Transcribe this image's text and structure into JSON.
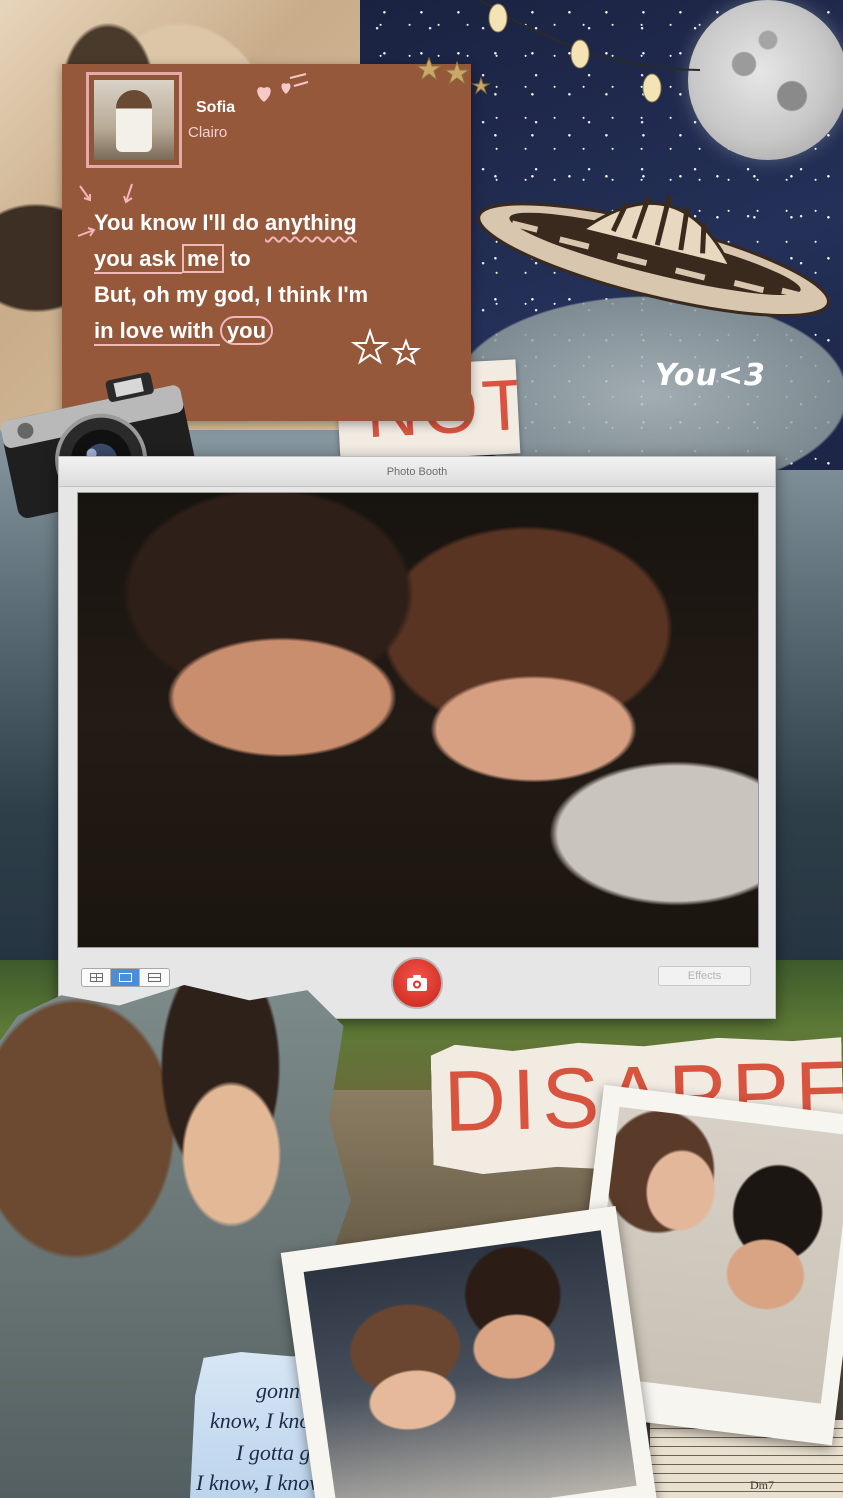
{
  "window": {
    "title": "Photo Booth",
    "effects_label": "Effects",
    "view_modes": [
      "four-up",
      "single",
      "filmstrip"
    ],
    "active_view": "single"
  },
  "lyrics_card": {
    "artist": "Sofia",
    "song": "Clairo",
    "lines": [
      {
        "before": "You know I'll do ",
        "emph": "anything",
        "after": ""
      },
      {
        "before": "you ask ",
        "emph": "me",
        "after": " to"
      },
      {
        "before": "But, oh my god, I think I'm",
        "emph": "",
        "after": ""
      },
      {
        "before": "in love with ",
        "emph": "you",
        "after": ""
      }
    ]
  },
  "collage_text": {
    "not_word": "NOT",
    "disappear_word": "DISAPPEAR",
    "you_heart": "You<3",
    "handwritten_lines": [
      "gonna c",
      "know, I know,",
      "I gotta go n",
      "I know, I know,"
    ],
    "chord": "Dm7"
  },
  "colors": {
    "card_brown": "#96583a",
    "accent_pink": "#f0b8b8",
    "scrap_red": "#d9543f",
    "shutter_red": "#e2372c",
    "active_blue": "#4a8ed8"
  },
  "icons": {
    "shutter": "camera-icon",
    "view_modes": [
      "grid-icon",
      "single-view-icon",
      "filmstrip-icon"
    ]
  }
}
